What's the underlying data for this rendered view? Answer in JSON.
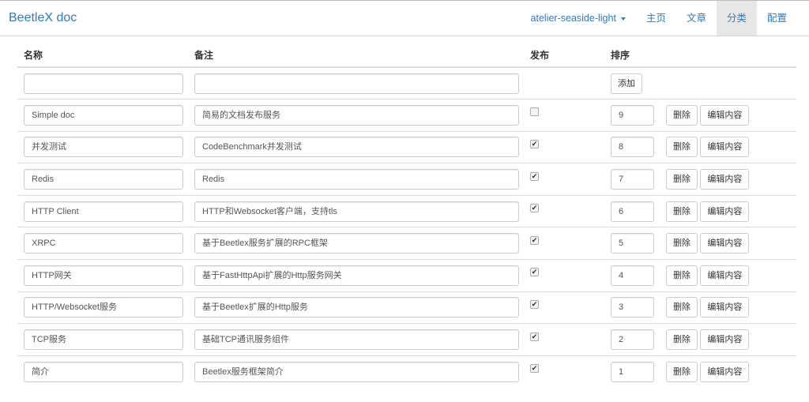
{
  "nav": {
    "brand": "BeetleX doc",
    "theme": "atelier-seaside-light",
    "items": [
      "主页",
      "文章",
      "分类",
      "配置"
    ],
    "active": "分类"
  },
  "headers": {
    "name": "名称",
    "note": "备注",
    "publish": "发布",
    "order": "排序"
  },
  "add_button": "添加",
  "delete_label": "删除",
  "edit_label": "编辑内容",
  "rows": [
    {
      "name": "Simple doc",
      "note": "简易的文档发布服务",
      "published": false,
      "order": "9"
    },
    {
      "name": "并发测试",
      "note": "CodeBenchmark并发测试",
      "published": true,
      "order": "8"
    },
    {
      "name": "Redis",
      "note": "Redis",
      "published": true,
      "order": "7"
    },
    {
      "name": "HTTP Client",
      "note": "HTTP和Websocket客户端，支持tls",
      "published": true,
      "order": "6"
    },
    {
      "name": "XRPC",
      "note": "基于Beetlex服务扩展的RPC框架",
      "published": true,
      "order": "5"
    },
    {
      "name": "HTTP网关",
      "note": "基于FastHttpApi扩展的Http服务网关",
      "published": true,
      "order": "4"
    },
    {
      "name": "HTTP/Websocket服务",
      "note": "基于Beetlex扩展的Http服务",
      "published": true,
      "order": "3"
    },
    {
      "name": "TCP服务",
      "note": "基础TCP通讯服务组件",
      "published": true,
      "order": "2"
    },
    {
      "name": "简介",
      "note": "Beetlex服务框架简介",
      "published": true,
      "order": "1"
    }
  ]
}
